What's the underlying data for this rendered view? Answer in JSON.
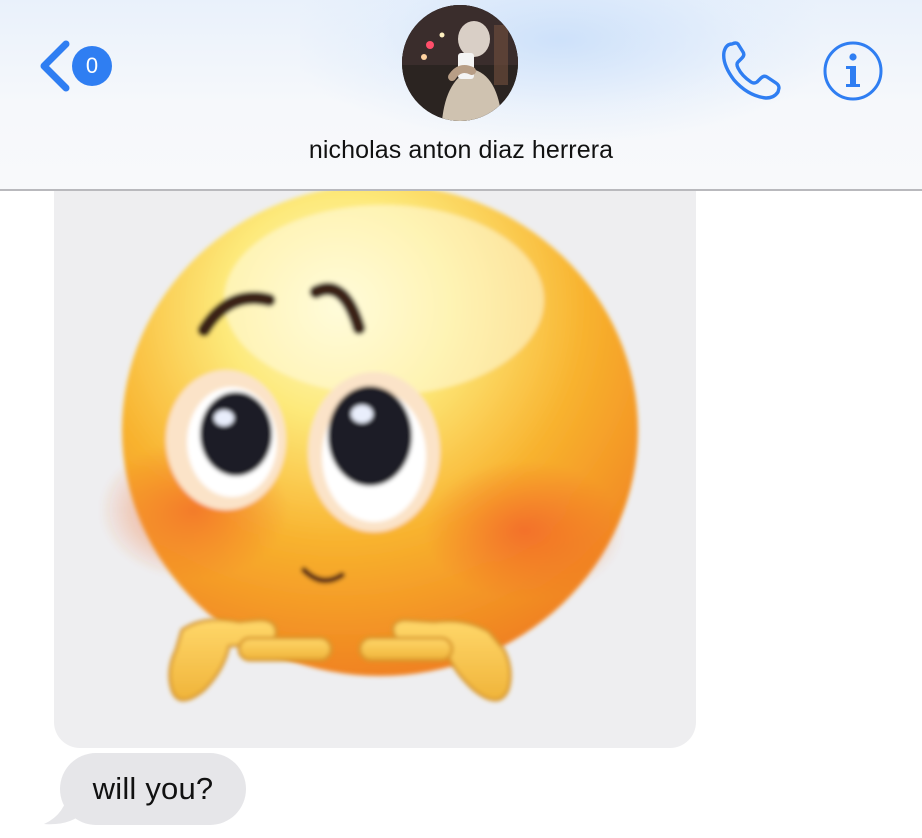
{
  "header": {
    "unread_count": "0",
    "contact_name": "nicholas anton diaz herrera"
  },
  "icons": {
    "back": "chevron-left-icon",
    "call": "phone-icon",
    "info": "info-icon",
    "avatar": "contact-photo"
  },
  "conversation": {
    "messages": [
      {
        "type": "image",
        "content": "blushing-emoji-pointing-fingers"
      },
      {
        "type": "text",
        "text": "will you?"
      }
    ]
  },
  "colors": {
    "accent": "#2f7ef2",
    "incoming_bubble": "#e6e6e9",
    "header_background": "#f6f8fb"
  }
}
